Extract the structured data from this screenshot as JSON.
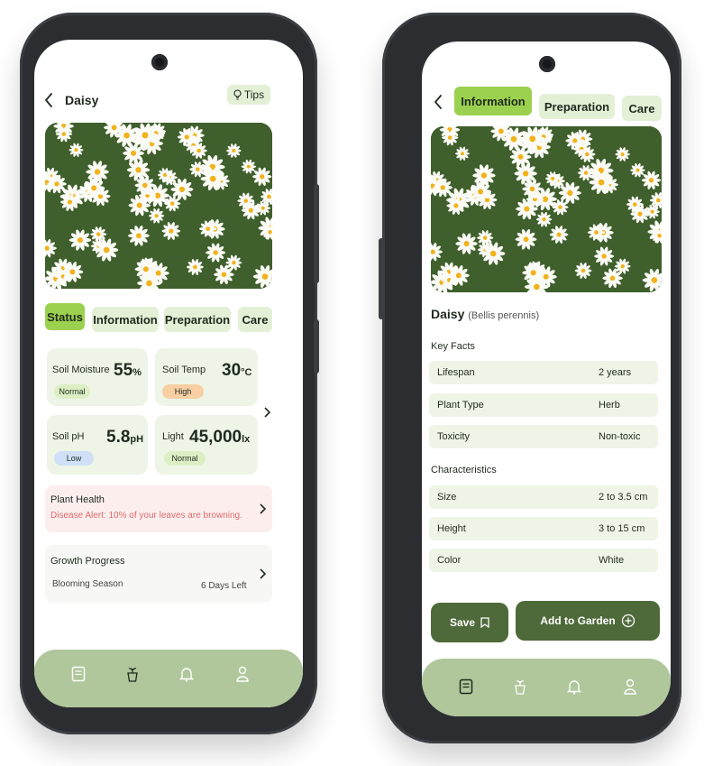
{
  "left": {
    "header": {
      "back": "<",
      "title": "Daisy",
      "tips_label": "Tips"
    },
    "tabs": [
      {
        "label": "Status",
        "active": true
      },
      {
        "label": "Information",
        "active": false
      },
      {
        "label": "Preparation",
        "active": false
      },
      {
        "label": "Care",
        "active": false
      }
    ],
    "cards": [
      {
        "label": "Soil Moisture",
        "value": "55",
        "unit": "%",
        "badge": "Normal",
        "badge_color": "#dcefc4"
      },
      {
        "label": "Soil Temp",
        "value": "30",
        "unit": "°C",
        "badge": "High",
        "badge_color": "#f7cfa3"
      },
      {
        "label": "Soil pH",
        "value": "5.8",
        "unit": "pH",
        "badge": "Low",
        "badge_color": "#cfe0f7"
      },
      {
        "label": "Light",
        "value": "45,000",
        "unit": "lx",
        "badge": "Normal",
        "badge_color": "#dcefc4"
      }
    ],
    "health": {
      "title": "Plant Health",
      "alert": "Disease Alert: 10% of your leaves are browning."
    },
    "growth": {
      "title": "Growth Progress",
      "stage": "Blooming Season",
      "remaining": "6 Days Left"
    }
  },
  "right": {
    "tabs": [
      {
        "label": "Information",
        "active": true
      },
      {
        "label": "Preparation",
        "active": false
      },
      {
        "label": "Care",
        "active": false
      }
    ],
    "name": "Daisy",
    "scientific": "(Bellis perennis)",
    "key_facts_title": "Key Facts",
    "key_facts": [
      {
        "k": "Lifespan",
        "v": "2 years"
      },
      {
        "k": "Plant Type",
        "v": "Herb"
      },
      {
        "k": "Toxicity",
        "v": "Non-toxic"
      }
    ],
    "characteristics_title": "Characteristics",
    "characteristics": [
      {
        "k": "Size",
        "v": "2 to 3.5 cm"
      },
      {
        "k": "Height",
        "v": "3 to 15 cm"
      },
      {
        "k": "Color",
        "v": "White"
      }
    ],
    "save_label": "Save",
    "add_label": "Add to Garden"
  },
  "nav_icons": [
    "book-icon",
    "plant-pot-icon",
    "bell-icon",
    "profile-icon"
  ],
  "colors": {
    "accent": "#9bd14e",
    "chip": "#e3f0d6",
    "navbar": "#afc79b",
    "dark_button": "#4e6a3a",
    "alert": "#e06a6a",
    "alert_bg": "#fdeeee"
  }
}
